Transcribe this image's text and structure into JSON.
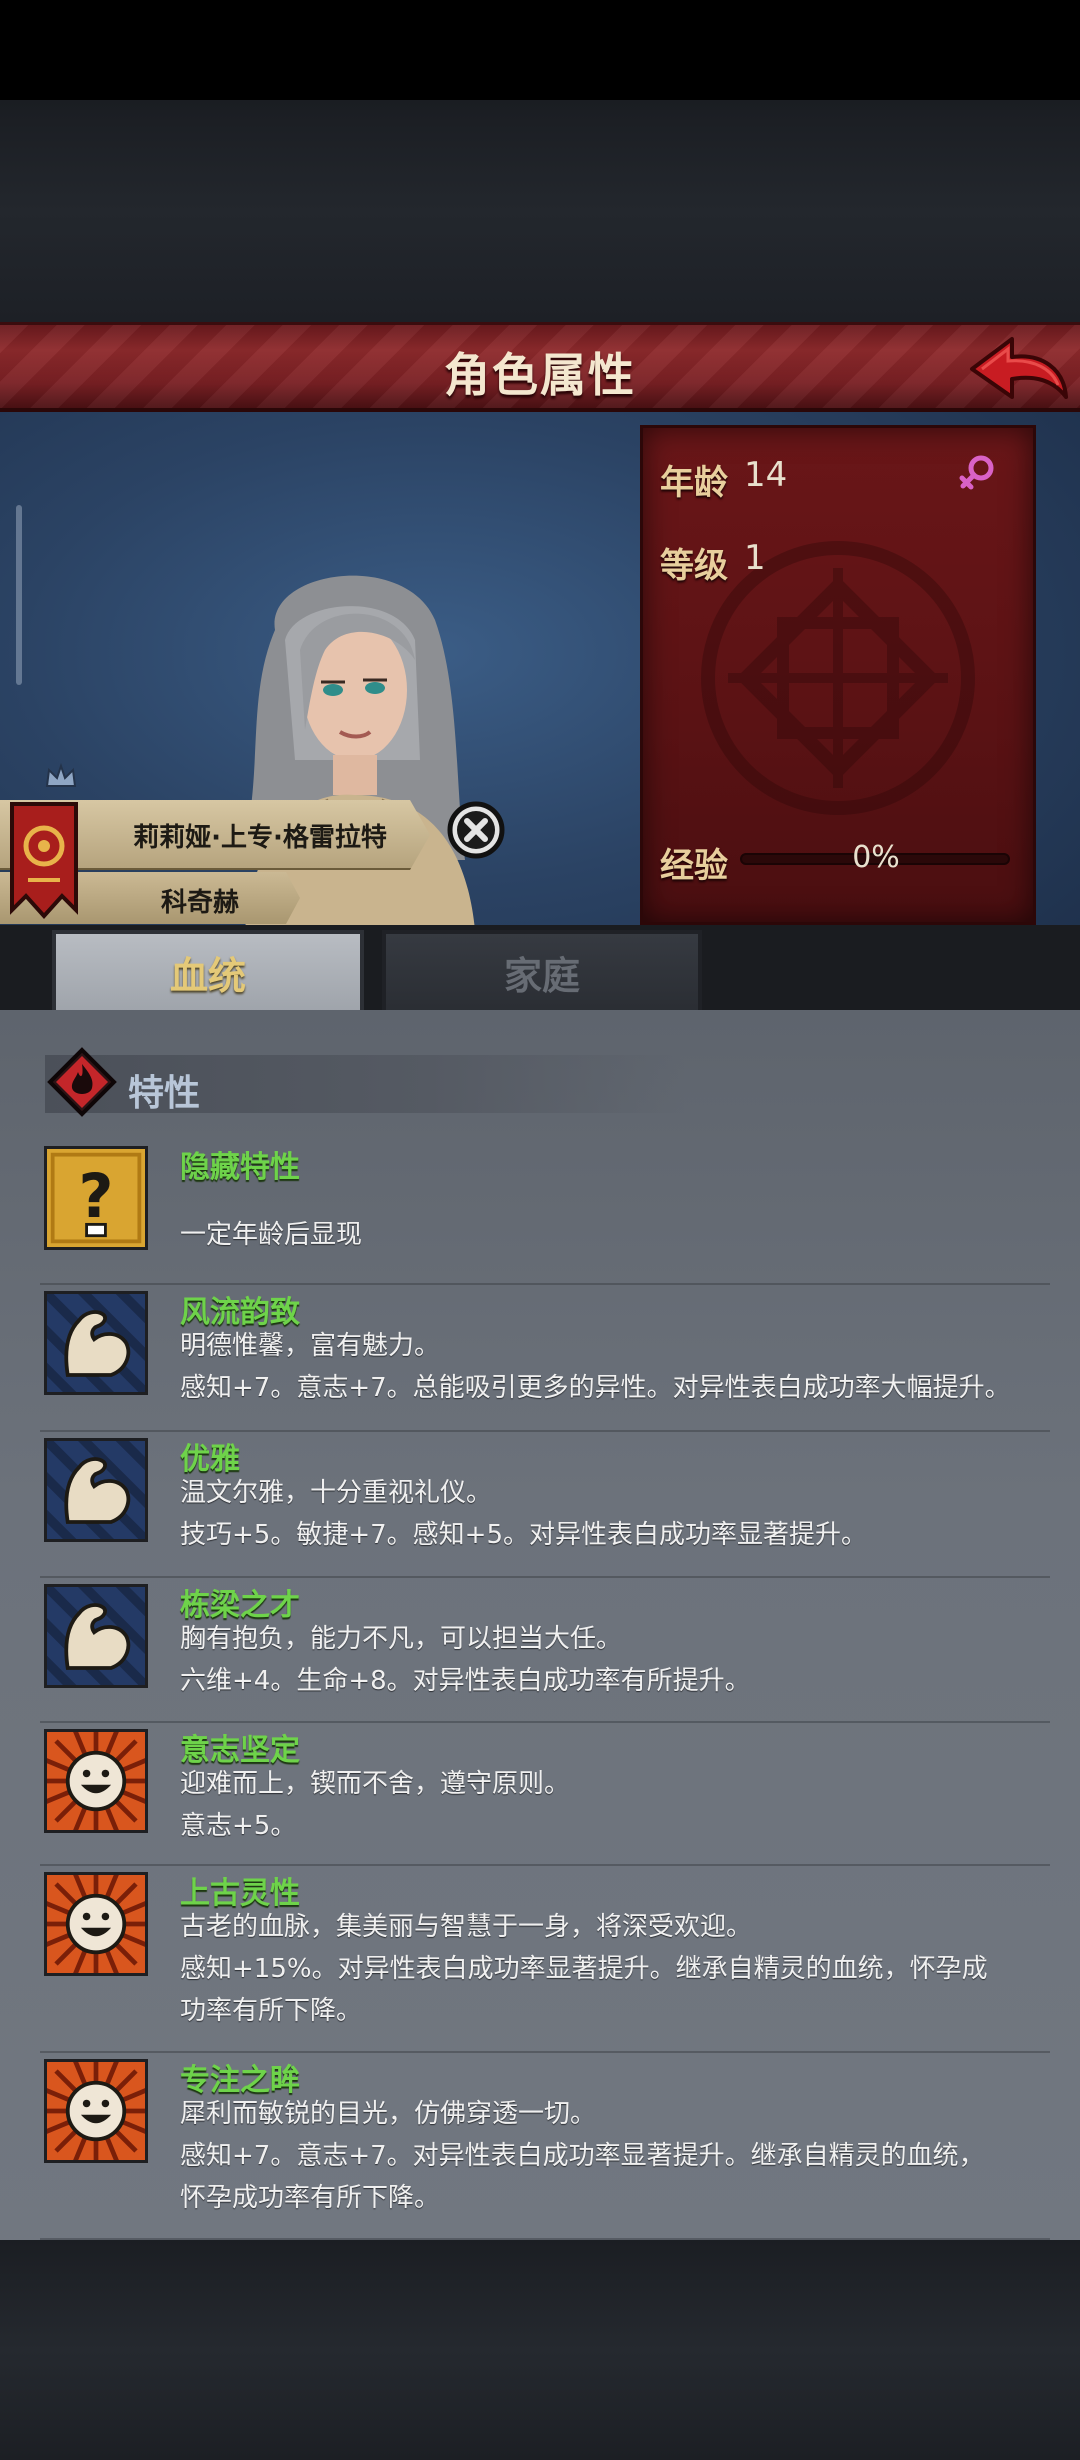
{
  "header": {
    "title": "角色属性",
    "back_icon": "red-arrow-back-icon"
  },
  "character": {
    "name": "莉莉娅·上专·格雷拉特",
    "family": "科奇赫",
    "house_icon": "house-banner-icon",
    "crown_icon": "crown-icon",
    "remove_icon": "close-icon"
  },
  "stats": {
    "age_label": "年龄",
    "age_value": "14",
    "level_label": "等级",
    "level_value": "1",
    "exp_label": "经验",
    "exp_value": "0%",
    "exp_fraction": 0.0,
    "gender_icon": "female-icon"
  },
  "tabs": [
    {
      "label": "血统",
      "active": true
    },
    {
      "label": "家庭",
      "active": false
    }
  ],
  "section": {
    "title": "特性",
    "icon": "fire-diamond-icon"
  },
  "traits": [
    {
      "name": "隐藏特性",
      "line1": "",
      "line2": "一定年龄后显现",
      "line3": "",
      "icon": "question-mark-icon"
    },
    {
      "name": "风流韵致",
      "line1": "明德惟馨，富有魅力。",
      "line2": "感知+7。意志+7。总能吸引更多的异性。对异性表白成功率大幅提升。",
      "line3": "",
      "icon": "muscle-arm-icon"
    },
    {
      "name": "优雅",
      "line1": "温文尔雅，十分重视礼仪。",
      "line2": "技巧+5。敏捷+7。感知+5。对异性表白成功率显著提升。",
      "line3": "",
      "icon": "muscle-arm-icon"
    },
    {
      "name": "栋梁之才",
      "line1": "胸有抱负，能力不凡，可以担当大任。",
      "line2": "六维+4。生命+8。对异性表白成功率有所提升。",
      "line3": "",
      "icon": "muscle-arm-icon"
    },
    {
      "name": "意志坚定",
      "line1": "迎难而上，锲而不舍，遵守原则。",
      "line2": "意志+5。",
      "line3": "",
      "icon": "smiley-sun-icon"
    },
    {
      "name": "上古灵性",
      "line1": "古老的血脉，集美丽与智慧于一身，将深受欢迎。",
      "line2": "感知+15%。对异性表白成功率显著提升。继承自精灵的血统，怀孕成",
      "line3": "功率有所下降。",
      "icon": "smiley-sun-icon"
    },
    {
      "name": "专注之眸",
      "line1": "犀利而敏锐的目光，仿佛穿透一切。",
      "line2": "感知+7。意志+7。对异性表白成功率显著提升。继承自精灵的血统，",
      "line3": "怀孕成功率有所下降。",
      "icon": "smiley-sun-icon"
    }
  ]
}
